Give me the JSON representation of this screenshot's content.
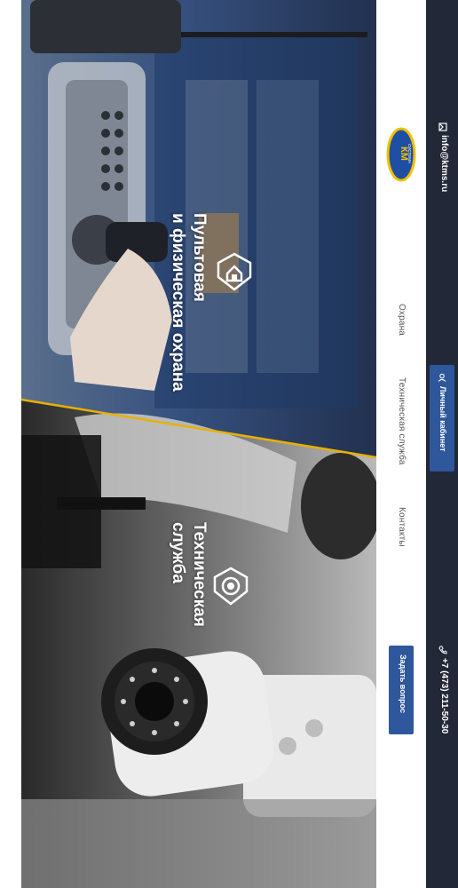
{
  "hero": {
    "panel_security": {
      "title_line1": "Пультовая",
      "title_line2": "и физическая охрана"
    },
    "panel_tech": {
      "title_line1": "Техническая",
      "title_line2": "служба"
    }
  },
  "nav": {
    "logo_text": "КМ",
    "logo_subtext": "СИСТЕМА",
    "links": [
      {
        "label": "Охрана"
      },
      {
        "label": "Техническая служба"
      },
      {
        "label": "Контакты"
      }
    ],
    "ask_button": "Задать вопрос"
  },
  "topbar": {
    "email": "info@ktms.ru",
    "cabinet_button": "Личный кабинет",
    "phone": "+7 (473) 211-50-30"
  },
  "colors": {
    "accent_blue": "#2f579b",
    "dark_bar": "#232838",
    "divider_gold": "#e8b100",
    "icons": [
      "mail-icon",
      "user-icon",
      "phone-icon",
      "shield-house-icon",
      "camera-shield-icon"
    ]
  }
}
